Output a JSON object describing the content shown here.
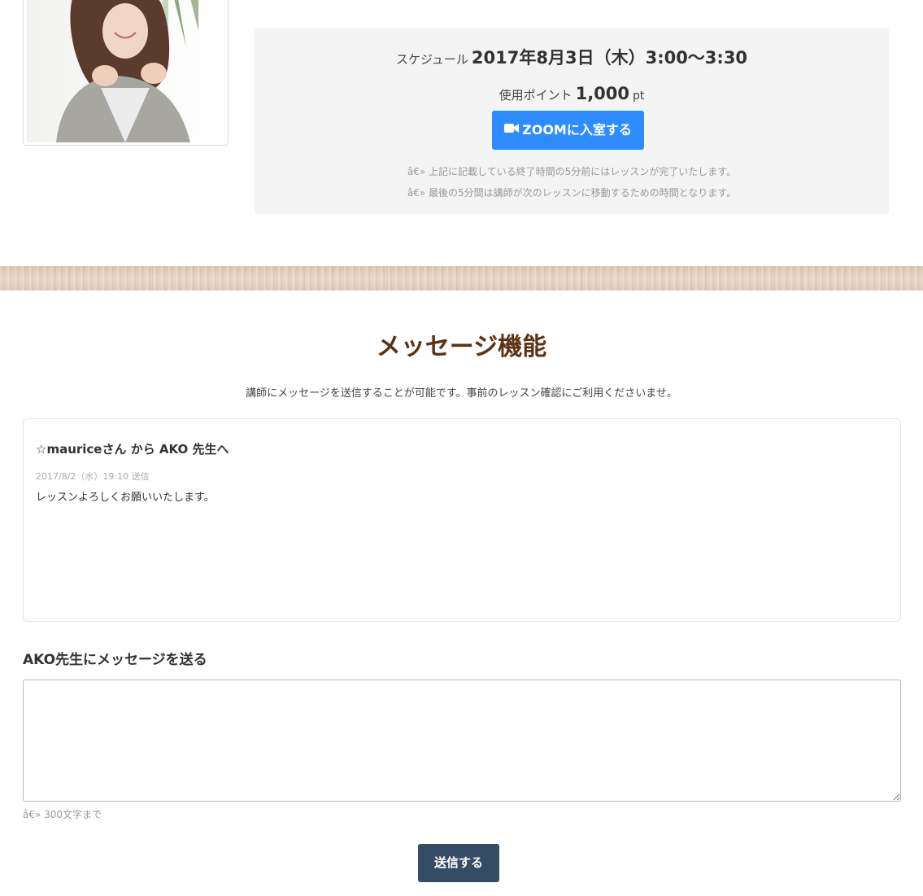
{
  "lesson": {
    "schedule_label": "スケジュール",
    "schedule_value": "2017年8月3日（木）3:00〜3:30",
    "points_label": "使用ポイント",
    "points_value": "1,000",
    "points_unit": "pt",
    "zoom_button_label": "ZOOMに入室する",
    "zoom_icon": "video-camera-icon",
    "note_1": "â€» 上記に記載している終了時間の5分前にはレッスンが完了いたします。",
    "note_2": "â€» 最後の5分間は講師が次のレッスンに移動するための時間となります。",
    "accent_color": "#2d8cff"
  },
  "message_section": {
    "title": "メッセージ機能",
    "description": "講師にメッセージを送信することが可能です。事前のレッスン確認にご利用くださいませ。",
    "title_color": "#5a3315",
    "messages": [
      {
        "header": "☆mauriceさん から AKO 先生へ",
        "date": "2017/8/2（水）19:10 送信",
        "body": "レッスンよろしくお願いいたします。"
      }
    ],
    "send_heading": "AKO先生にメッセージを送る",
    "input_value": "",
    "char_limit_note": "â€» 300文字まで",
    "submit_label": "送信する",
    "submit_color": "#344d64"
  }
}
